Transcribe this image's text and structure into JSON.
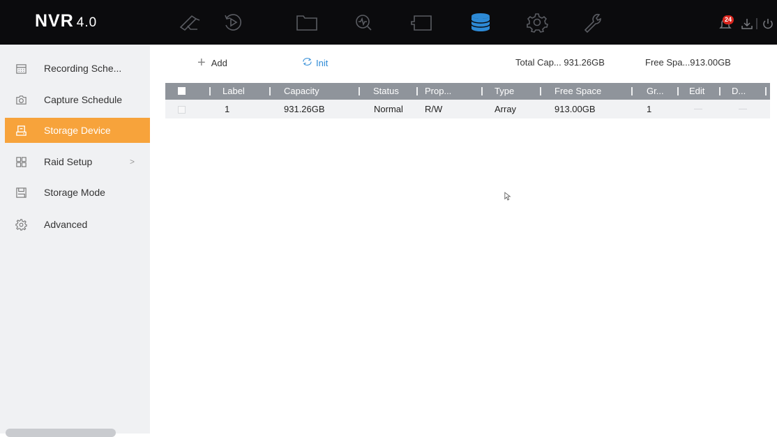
{
  "app": {
    "logo": "NVR",
    "version": "4.0",
    "notification_count": "24"
  },
  "top_nav": [
    {
      "icon": "camera-icon"
    },
    {
      "icon": "playback-icon"
    },
    {
      "icon": "folder-icon"
    },
    {
      "icon": "search-icon"
    },
    {
      "icon": "display-icon"
    },
    {
      "icon": "storage-icon",
      "active": true
    },
    {
      "icon": "settings-icon"
    },
    {
      "icon": "maintenance-icon"
    }
  ],
  "sidebar": {
    "items": [
      {
        "label": "Recording Sche...",
        "icon": "calendar-icon"
      },
      {
        "label": "Capture Schedule",
        "icon": "camera-snapshot-icon"
      },
      {
        "label": "Storage Device",
        "icon": "storage-device-icon",
        "active": true
      },
      {
        "label": "Raid Setup",
        "icon": "grid-icon",
        "chevron": ">"
      },
      {
        "label": "Storage Mode",
        "icon": "disk-icon"
      },
      {
        "label": "Advanced",
        "icon": "gear-icon"
      }
    ]
  },
  "toolbar": {
    "add_label": "Add",
    "init_label": "Init",
    "total_capacity": "Total Cap... 931.26GB",
    "free_space": "Free Spa...913.00GB"
  },
  "table": {
    "headers": [
      "Label",
      "Capacity",
      "Status",
      "Prop...",
      "Type",
      "Free Space",
      "Gr...",
      "Edit",
      "D..."
    ],
    "rows": [
      {
        "label": "1",
        "capacity": "931.26GB",
        "status": "Normal",
        "property": "R/W",
        "type": "Array",
        "free_space": "913.00GB",
        "group": "1"
      }
    ]
  },
  "colors": {
    "topbar": "#0b0b0d",
    "accent": "#f7a33b",
    "active_nav": "#2d8ad6",
    "table_header": "#8f949b",
    "badge": "#d9251d"
  }
}
